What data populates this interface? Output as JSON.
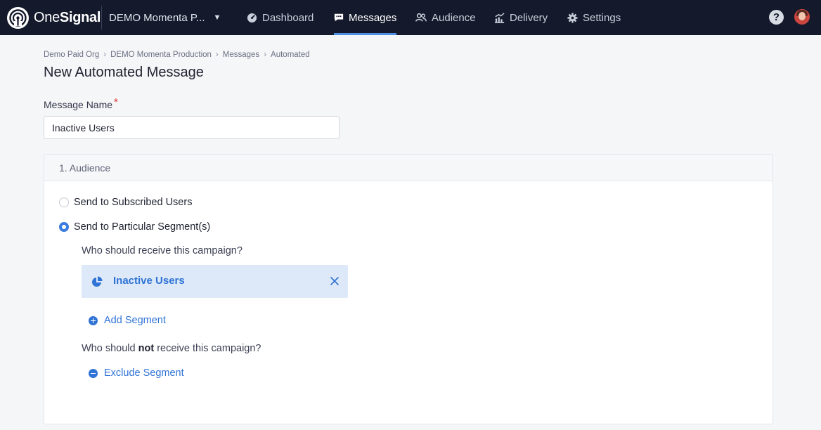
{
  "topbar": {
    "logo_text_light": "One",
    "logo_text_bold": "Signal",
    "app_name": "DEMO Momenta P...",
    "nav": [
      {
        "label": "Dashboard",
        "icon": "dashboard-icon"
      },
      {
        "label": "Messages",
        "icon": "messages-icon",
        "active": true
      },
      {
        "label": "Audience",
        "icon": "audience-icon"
      },
      {
        "label": "Delivery",
        "icon": "delivery-icon"
      },
      {
        "label": "Settings",
        "icon": "settings-icon"
      }
    ],
    "help_label": "?"
  },
  "breadcrumb": [
    "Demo Paid Org",
    "DEMO Momenta Production",
    "Messages",
    "Automated"
  ],
  "page_title": "New Automated Message",
  "form": {
    "message_name_label": "Message Name",
    "required_mark": "*",
    "message_name_value": "Inactive Users"
  },
  "audience": {
    "header": "1. Audience",
    "option_subscribed": "Send to Subscribed Users",
    "option_segments": "Send to Particular Segment(s)",
    "selected_option": "segments",
    "include_question": "Who should receive this campaign?",
    "included_segments": [
      "Inactive Users"
    ],
    "add_segment_label": "Add Segment",
    "exclude_question_before": "Who should",
    "exclude_question_bold": "not",
    "exclude_question_after": "receive this campaign?",
    "exclude_segment_label": "Exclude Segment"
  },
  "colors": {
    "nav_bg": "#14192b",
    "accent": "#2f73d6",
    "required": "#e0322f",
    "segment_bg": "#dde9f8"
  }
}
